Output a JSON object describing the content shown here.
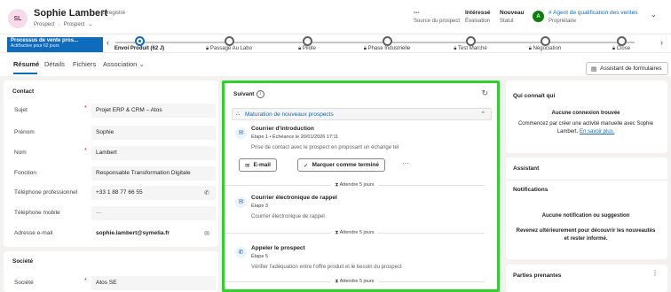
{
  "record": {
    "initials": "SL",
    "name": "Sophie Lambert",
    "saved_status": "- Enregistré",
    "entity": "Prospect",
    "form": "Prospect"
  },
  "header_fields": [
    {
      "value": "---",
      "label": "Source du prospect"
    },
    {
      "value": "Intéressé",
      "label": "Évaluation"
    },
    {
      "value": "Nouveau",
      "label": "Statut"
    }
  ],
  "owner": {
    "initial": "A",
    "name": "# Agent de qualification des ventes",
    "role": "Propriétaire"
  },
  "process": {
    "name": "Processus de vente pros...",
    "status": "Actif/active pour 62 jours",
    "stages": [
      {
        "label": "Envoi Produit  (62 J)",
        "active": true
      },
      {
        "label": "Passage Au Labo",
        "active": false
      },
      {
        "label": "Pilote",
        "active": false
      },
      {
        "label": "Phase Industrielle",
        "active": false
      },
      {
        "label": "Test Marché",
        "active": false
      },
      {
        "label": "Négociation",
        "active": false
      },
      {
        "label": "Close",
        "active": false
      }
    ]
  },
  "tabs": [
    "Résumé",
    "Détails",
    "Fichiers",
    "Association"
  ],
  "form_assistant_label": "Assistant de formulaires",
  "contact": {
    "title": "Contact",
    "fields": [
      {
        "label": "Sujet",
        "value": "Projet ERP & CRM – Atos",
        "required": true
      },
      {
        "label": "Prénom",
        "value": "Sophie",
        "required": false
      },
      {
        "label": "Nom",
        "value": "Lambert",
        "required": true
      },
      {
        "label": "Fonction",
        "value": "Responsable Transformation Digitale",
        "required": false
      },
      {
        "label": "Téléphone professionnel",
        "value": "+33 1 88 77 66 55",
        "required": false
      },
      {
        "label": "Téléphone mobile",
        "value": "---",
        "required": false
      },
      {
        "label": "Adresse e-mail",
        "value": "sophie.lambert@symelia.fr",
        "required": false
      }
    ]
  },
  "company": {
    "title": "Société",
    "fields": [
      {
        "label": "Société",
        "value": "Atos SE",
        "required": true
      }
    ]
  },
  "timeline": {
    "title": "Suivant",
    "sequence": "Maturation de nouveaux prospects",
    "activities": [
      {
        "title": "Courrier d'introduction",
        "meta": "Étape 1 • Échéance le 20/01/2026 17:11",
        "desc": "Prise de contact avec le prospect en proposant un échange tel"
      },
      {
        "title": "Courrier électronique de rappel",
        "meta": "Étape 3",
        "desc": "Courrier électronique de rappel"
      },
      {
        "title": "Appeler le prospect",
        "meta": "Étape 5",
        "desc": "Vérifier l'adéquation entre l'offre produit et le besoin du prospect"
      }
    ],
    "email_button": "E-mail",
    "complete_button": "Marquer comme terminé",
    "wait_label": "Attendre 5 jours"
  },
  "right": {
    "who_knows_title": "Qui connaît qui",
    "no_connection": "Aucune connexion trouvée",
    "no_connection_desc1": "Commencez par créer une activité manuelle avec Sophie",
    "no_connection_desc2": "Lambert.",
    "learn_more": "En savoir plus.",
    "assistant_title": "Assistant",
    "notifications_title": "Notifications",
    "no_notification": "Aucune notification ou suggestion",
    "notif_desc1": "Revenez ultérieurement pour découvrir les nouveautés",
    "notif_desc2": "et rester informé.",
    "stakeholders_title": "Parties prenantes"
  },
  "colors": {
    "accent": "#0f6cbd",
    "highlight_border": "#2fd12f"
  }
}
